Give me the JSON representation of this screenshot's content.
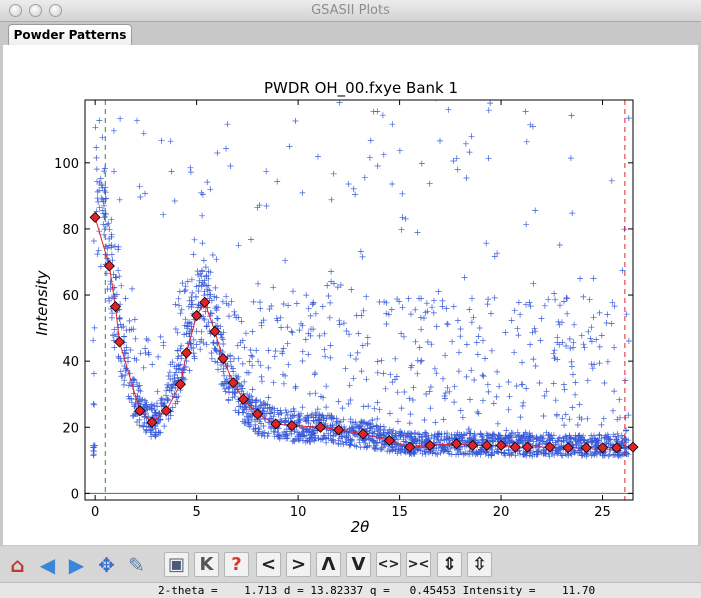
{
  "window": {
    "title": "GSASII Plots"
  },
  "tabs": [
    {
      "label": "Powder Patterns"
    }
  ],
  "status": {
    "text": "2-theta =    1.713 d = 13.82337 q =   0.45453 Intensity =    11.70"
  },
  "toolbar": {
    "buttons": [
      {
        "name": "home-button",
        "icon": "home-icon",
        "glyph": "⌂",
        "color": "#c0392b"
      },
      {
        "name": "back-button",
        "icon": "back-arrow-icon",
        "glyph": "◀",
        "color": "#3a86d8"
      },
      {
        "name": "forward-button",
        "icon": "forward-arrow-icon",
        "glyph": "▶",
        "color": "#3a86d8"
      },
      {
        "name": "pan-button",
        "icon": "pan-icon",
        "glyph": "✥",
        "color": "#3a6fd0"
      },
      {
        "name": "zoom-button",
        "icon": "zoom-icon",
        "glyph": "✎",
        "color": "#5a7fa8"
      },
      {
        "name": "save-button",
        "icon": "save-icon",
        "glyph": "▣",
        "color": "#4a5a78"
      },
      {
        "name": "key-button",
        "icon": "key-icon",
        "glyph": "K",
        "color": "#555555"
      },
      {
        "name": "help-button",
        "icon": "help-icon",
        "glyph": "?",
        "color": "#d63a2a"
      },
      {
        "name": "shift-left-button",
        "icon": "chevron-left-icon",
        "glyph": "<",
        "color": "#222222"
      },
      {
        "name": "shift-right-button",
        "icon": "chevron-right-icon",
        "glyph": ">",
        "color": "#222222"
      },
      {
        "name": "shift-up-button",
        "icon": "chevron-up-icon",
        "glyph": "Λ",
        "color": "#222222"
      },
      {
        "name": "shift-down-button",
        "icon": "chevron-down-icon",
        "glyph": "V",
        "color": "#222222"
      },
      {
        "name": "expand-x-button",
        "icon": "expand-x-icon",
        "glyph": "<>",
        "color": "#222222"
      },
      {
        "name": "contract-x-button",
        "icon": "contract-x-icon",
        "glyph": "><",
        "color": "#222222"
      },
      {
        "name": "expand-y-button",
        "icon": "expand-y-icon",
        "glyph": "⇕",
        "color": "#222222"
      },
      {
        "name": "contract-y-button",
        "icon": "contract-y-icon",
        "glyph": "⇳",
        "color": "#222222"
      }
    ]
  },
  "chart_data": {
    "type": "scatter",
    "title": "PWDR OH_00.fxye Bank 1",
    "xlabel": "2θ",
    "ylabel": "Intensity",
    "xlim": [
      -0.5,
      26.5
    ],
    "ylim": [
      -2,
      119
    ],
    "xticks": [
      0,
      5,
      10,
      15,
      20,
      25
    ],
    "yticks": [
      0,
      20,
      40,
      60,
      80,
      100
    ],
    "colors": {
      "observed": "#3a5bd8",
      "background": "#e0222b",
      "excluded_low": "#2e8b3a",
      "excluded_high": "#e0222b",
      "zero_line": "#2e8b3a"
    },
    "excluded_region_lines": {
      "low": 0.5,
      "high": 26.1
    },
    "background_points": [
      [
        0.0,
        83.5
      ],
      [
        0.7,
        68.8
      ],
      [
        1.0,
        56.5
      ],
      [
        1.2,
        45.8
      ],
      [
        2.2,
        25.0
      ],
      [
        2.8,
        21.5
      ],
      [
        3.5,
        25.0
      ],
      [
        4.2,
        33.0
      ],
      [
        4.5,
        42.5
      ],
      [
        5.0,
        53.8
      ],
      [
        5.4,
        57.8
      ],
      [
        5.9,
        49.0
      ],
      [
        6.3,
        40.8
      ],
      [
        6.8,
        33.5
      ],
      [
        7.3,
        28.5
      ],
      [
        8.0,
        24.0
      ],
      [
        8.9,
        21.0
      ],
      [
        9.7,
        20.5
      ],
      [
        11.1,
        20.0
      ],
      [
        12.0,
        19.2
      ],
      [
        13.2,
        18.0
      ],
      [
        14.5,
        16.0
      ],
      [
        15.5,
        14.0
      ],
      [
        16.5,
        14.5
      ],
      [
        17.8,
        15.0
      ],
      [
        18.6,
        14.5
      ],
      [
        19.3,
        14.5
      ],
      [
        20.0,
        14.5
      ],
      [
        20.7,
        14.0
      ],
      [
        21.3,
        14.0
      ],
      [
        22.4,
        14.0
      ],
      [
        23.3,
        13.8
      ],
      [
        24.2,
        13.8
      ],
      [
        25.0,
        13.8
      ],
      [
        25.7,
        13.8
      ],
      [
        26.5,
        14.0
      ]
    ],
    "observed_profile": [
      [
        0.0,
        95
      ],
      [
        0.3,
        88
      ],
      [
        0.6,
        70
      ],
      [
        0.9,
        58
      ],
      [
        1.2,
        48
      ],
      [
        1.5,
        38
      ],
      [
        1.8,
        30
      ],
      [
        2.2,
        26
      ],
      [
        2.6,
        22
      ],
      [
        3.0,
        22
      ],
      [
        3.4,
        25
      ],
      [
        3.8,
        30
      ],
      [
        4.2,
        38
      ],
      [
        4.6,
        47
      ],
      [
        5.0,
        54
      ],
      [
        5.4,
        56
      ],
      [
        5.8,
        50
      ],
      [
        6.2,
        42
      ],
      [
        6.6,
        35
      ],
      [
        7.0,
        30
      ],
      [
        7.5,
        26
      ],
      [
        8.0,
        23
      ],
      [
        9.0,
        21
      ],
      [
        10.0,
        20
      ],
      [
        11.0,
        20
      ],
      [
        12.0,
        19
      ],
      [
        13.0,
        18
      ],
      [
        14.0,
        17
      ],
      [
        15.0,
        15.5
      ],
      [
        16.0,
        15
      ],
      [
        17.0,
        15
      ],
      [
        18.0,
        15
      ],
      [
        19.0,
        15
      ],
      [
        20.0,
        14.5
      ],
      [
        21.0,
        14.5
      ],
      [
        22.0,
        14.5
      ],
      [
        23.0,
        14.5
      ],
      [
        24.0,
        14.5
      ],
      [
        25.0,
        14.5
      ],
      [
        26.0,
        14.5
      ]
    ]
  }
}
